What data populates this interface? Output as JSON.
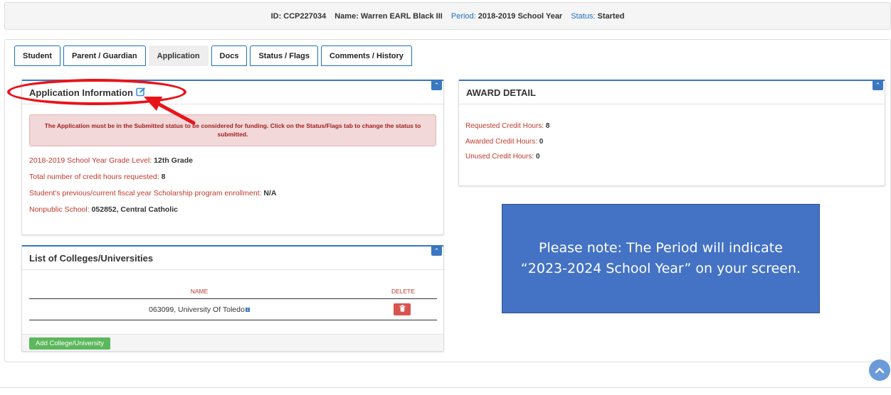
{
  "header": {
    "id_label": "ID:",
    "id_value": "CCP227034",
    "name_label": "Name:",
    "name_value": "Warren EARL Black III",
    "period_label": "Period:",
    "period_value": "2018-2019 School Year",
    "status_label": "Status:",
    "status_value": "Started"
  },
  "tabs": [
    {
      "label": "Student"
    },
    {
      "label": "Parent / Guardian"
    },
    {
      "label": "Application",
      "active": true
    },
    {
      "label": "Docs"
    },
    {
      "label": "Status / Flags"
    },
    {
      "label": "Comments / History"
    }
  ],
  "application_info": {
    "title": "Application Information",
    "alert": "The Application must be in the Submitted status to be considered for funding. Click on the Status/Flags tab to change the status to submitted.",
    "fields": [
      {
        "label": "2018-2019 School Year Grade Level:",
        "value": "12th Grade"
      },
      {
        "label": "Total number of credit hours requested:",
        "value": "8"
      },
      {
        "label": "Student's previous/current fiscal year Scholarship program enrollment:",
        "value": "N/A"
      },
      {
        "label": "Nonpublic School:",
        "value": "052852, Central Catholic"
      }
    ]
  },
  "award_detail": {
    "title": "AWARD DETAIL",
    "fields": [
      {
        "label": "Requested Credit Hours:",
        "value": "8"
      },
      {
        "label": "Awarded Credit Hours:",
        "value": "0"
      },
      {
        "label": "Unused Credit Hours:",
        "value": "0"
      }
    ]
  },
  "colleges": {
    "title": "List of Colleges/Universities",
    "col_name": "NAME",
    "col_delete": "DELETE",
    "rows": [
      {
        "name": "063099, University Of Toledo"
      }
    ],
    "add_button": "Add College/University"
  },
  "note": "Please note: The Period will indicate “2023-2024 School Year” on your screen.",
  "colors": {
    "accent_blue": "#3a78c0",
    "label_red": "#c0392b",
    "annotation_red": "#e8141a",
    "note_bg": "#4472c4",
    "add_green": "#5cb85c",
    "delete_red": "#d9534f"
  },
  "icons": {
    "edit": "edit-icon",
    "collapse": "chevron-up-icon",
    "delete": "trash-icon",
    "scroll_top": "chevron-up-icon",
    "info": "info-icon"
  }
}
